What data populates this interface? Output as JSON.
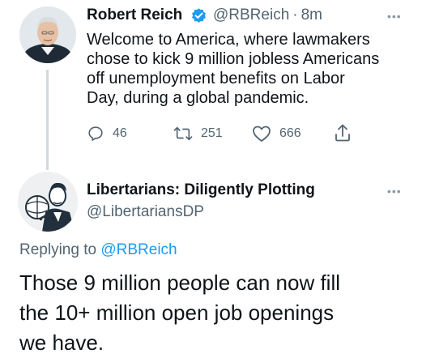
{
  "tweet1": {
    "author_name": "Robert Reich",
    "handle": "@RBReich",
    "separator": "·",
    "time": "8m",
    "more_label": "•••",
    "text_lines": [
      "Welcome to America, where lawmakers",
      "chose to kick 9 million jobless Americans",
      "off unemployment benefits on Labor",
      "Day, during a global pandemic."
    ],
    "reply_count": "46",
    "retweet_count": "251",
    "like_count": "666",
    "icons": [
      "reply-icon",
      "retweet-icon",
      "like-icon",
      "share-icon",
      "verified-badge-icon"
    ]
  },
  "tweet2": {
    "author_name": "Libertarians: Diligently Plotting",
    "handle": "@LibertariansDP",
    "more_label": "•••",
    "replying_prefix": "Replying to",
    "replying_handle": "@RBReich",
    "text_lines": [
      "Those 9 million people can now fill",
      "the 10+ million open job openings",
      "we have."
    ]
  },
  "colors": {
    "text": "#0f1419",
    "secondary": "#536471",
    "link": "#1d9bf0",
    "verified": "#1d9bf0",
    "thread_line": "#cfd9de"
  }
}
